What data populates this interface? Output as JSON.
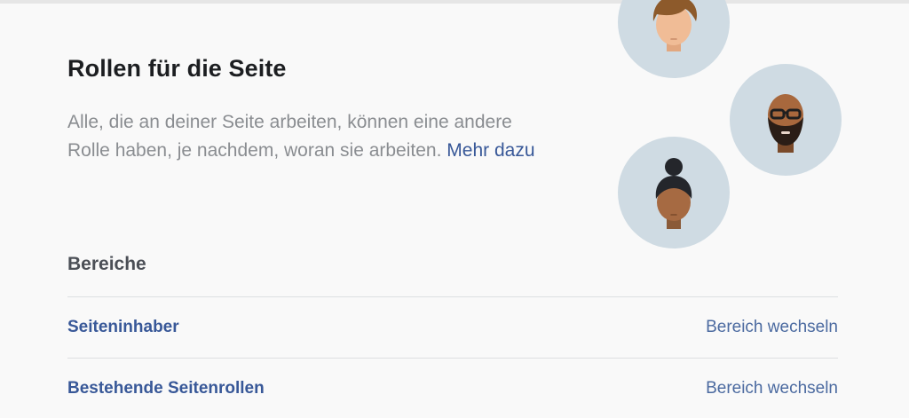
{
  "header": {
    "title": "Rollen für die Seite"
  },
  "description": {
    "text": "Alle, die an deiner Seite arbeiten, können eine andere Rolle haben, je nachdem, woran sie arbeiten.",
    "link_label": "Mehr dazu"
  },
  "avatars": [
    {
      "icon": "person-with-brown-hair-icon"
    },
    {
      "icon": "person-with-beard-and-glasses-icon"
    },
    {
      "icon": "person-with-hair-bun-icon"
    }
  ],
  "sections": {
    "heading": "Bereiche",
    "roles": [
      {
        "name": "Seiteninhaber",
        "action": "Bereich wechseln"
      },
      {
        "name": "Bestehende Seitenrollen",
        "action": "Bereich wechseln"
      }
    ]
  },
  "colors": {
    "link": "#385898",
    "avatar_bg": "#cfdbe3",
    "text_primary": "#1c1e21",
    "text_secondary": "#8a8d91"
  }
}
